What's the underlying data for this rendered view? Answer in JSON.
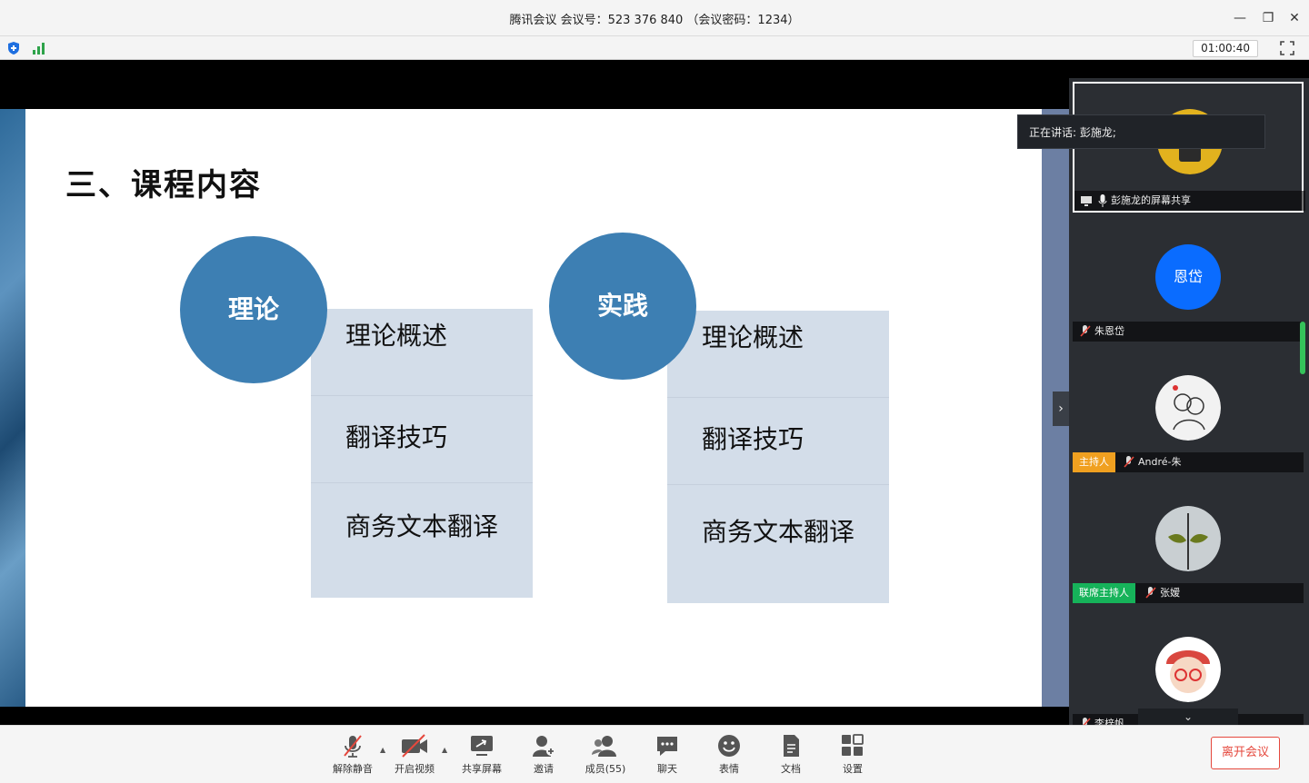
{
  "window": {
    "title": "腾讯会议 会议号：523 376 840 （会议密码：1234）",
    "timer": "01:00:40"
  },
  "slide": {
    "title": "三、课程内容",
    "groups": [
      {
        "circle": "理论",
        "items": [
          "理论概述",
          "翻译技巧",
          "商务文本翻译"
        ]
      },
      {
        "circle": "实践",
        "items": [
          "理论概述",
          "翻译技巧",
          "商务文本翻译"
        ]
      }
    ]
  },
  "sidebar": {
    "speaking": "正在讲话: 彭施龙;",
    "tiles": [
      {
        "label": "彭施龙的屏幕共享",
        "badge": "",
        "avatar_text": ""
      },
      {
        "label": "朱恩岱",
        "badge": "",
        "avatar_text": "恩岱"
      },
      {
        "label": "André-朱",
        "badge": "主持人",
        "avatar_text": ""
      },
      {
        "label": "张嫒",
        "badge": "联席主持人",
        "avatar_text": ""
      },
      {
        "label": "李梓帆",
        "badge": "",
        "avatar_text": ""
      }
    ],
    "colors": {
      "host": "#f0a020",
      "cohost": "#16b35a",
      "avatar_blue": "#0a6cff"
    }
  },
  "toolbar": {
    "unmute": "解除静音",
    "video": "开启视频",
    "share": "共享屏幕",
    "invite": "邀请",
    "members": "成员(55)",
    "chat": "聊天",
    "emoji": "表情",
    "docs": "文档",
    "settings": "设置",
    "leave": "离开会议"
  }
}
